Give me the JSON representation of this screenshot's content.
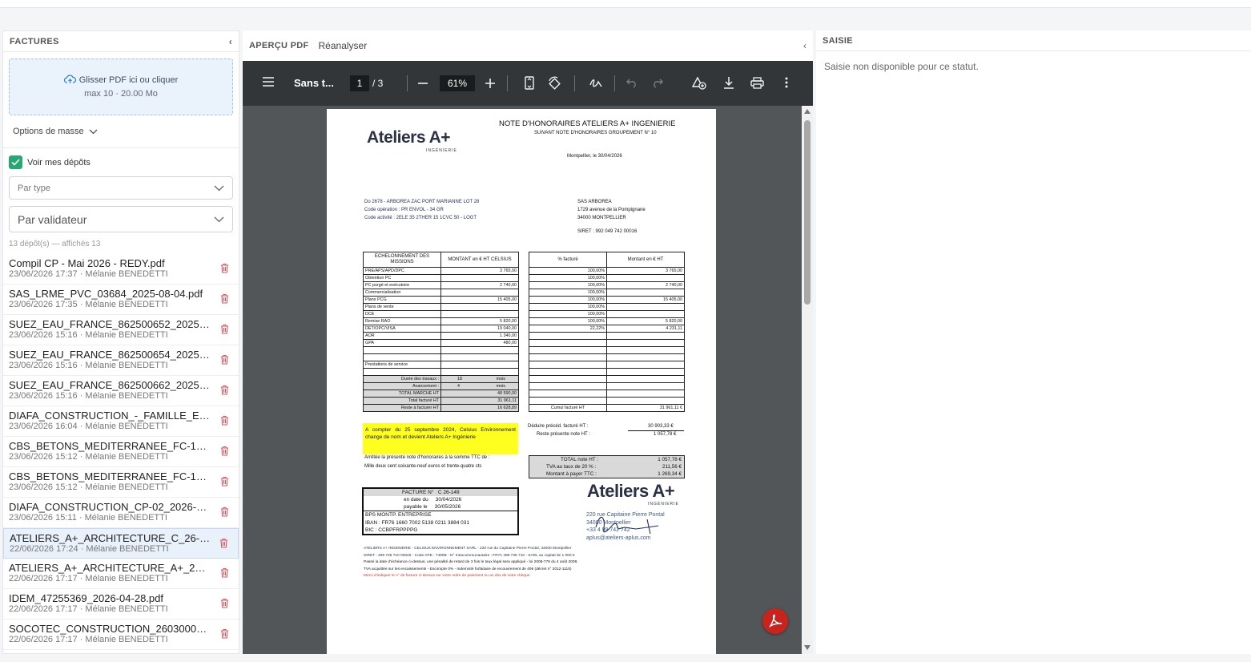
{
  "factures": {
    "title": "FACTURES",
    "collapse_icon": "‹",
    "dropzone_title": "Glisser PDF ici ou cliquer",
    "dropzone_limit": "max 10 · 20.00 Mo",
    "mass_options": "Options de masse",
    "show_mine_label": "Voir mes dépôts",
    "show_mine_checked": true,
    "filter_type": "Par type",
    "filter_validator": "Par validateur",
    "count_text": "13 dépôt(s) — affichés 13",
    "items": [
      {
        "name": "Compil CP - Mai 2026 - REDY.pdf",
        "meta": "23/06/2026 17:37 · Mélanie BENEDETTI"
      },
      {
        "name": "SAS_LRME_PVC_03684_2025-08-04.pdf",
        "meta": "23/06/2026 17:35 · Mélanie BENEDETTI"
      },
      {
        "name": "SUEZ_EAU_FRANCE_862500652_2025-...",
        "meta": "23/06/2026 15:16 · Mélanie BENEDETTI"
      },
      {
        "name": "SUEZ_EAU_FRANCE_862500654_2025-...",
        "meta": "23/06/2026 15:16 · Mélanie BENEDETTI"
      },
      {
        "name": "SUEZ_EAU_FRANCE_862500662_2025-...",
        "meta": "23/06/2026 15:16 · Mélanie BENEDETTI"
      },
      {
        "name": "DIAFA_CONSTRUCTION_-_FAMILLE_EA_...",
        "meta": "23/06/2026 16:04 · Mélanie BENEDETTI"
      },
      {
        "name": "CBS_BETONS_MEDITERRANEE_FC-154...",
        "meta": "23/06/2026 15:12 · Mélanie BENEDETTI"
      },
      {
        "name": "CBS_BETONS_MEDITERRANEE_FC-154...",
        "meta": "23/06/2026 15:12 · Mélanie BENEDETTI"
      },
      {
        "name": "DIAFA_CONSTRUCTION_CP-02_2026-0...",
        "meta": "23/06/2026 15:11 · Mélanie BENEDETTI"
      },
      {
        "name": "ATELIERS_A+_ARCHITECTURE_C_26-14...",
        "meta": "22/06/2026 17:24 · Mélanie BENEDETTI"
      },
      {
        "name": "ATELIERS_A+_ARCHITECTURE_A+_26-2...",
        "meta": "22/06/2026 17:17 · Mélanie BENEDETTI"
      },
      {
        "name": "IDEM_47255369_2026-04-28.pdf",
        "meta": "22/06/2026 17:17 · Mélanie BENEDETTI"
      },
      {
        "name": "SOCOTEC_CONSTRUCTION_26030002...",
        "meta": "22/06/2026 17:17 · Mélanie BENEDETTI"
      }
    ],
    "selected_index": 9
  },
  "preview": {
    "title": "APERÇU PDF",
    "reanalyse": "Réanalyser",
    "collapse_icon": "‹",
    "doc_title": "Sans t...",
    "page_current": "1",
    "page_total": "/ 3",
    "zoom": "61%"
  },
  "pdf": {
    "logo": "Ateliers A+",
    "logo_sub": "INGÉNIERIE",
    "heading": "NOTE D'HONORAIRES ATELIERS A+ INGENIERIE",
    "subheading": "SUIVANT NOTE D'HONORAIRES GROUPEMENT N° 10",
    "place_date": "Montpellier, le    30/04/2026",
    "project_lines": [
      "Do 2678 - ARBOREA ZAC PORT MARIANNE LOT 28",
      "Code opération : PR ENVOL - 34 GR",
      "Code activité : 2ELE 35 2THER 15 1CVC 50 - LOGT"
    ],
    "client_lines": [
      "SAS ARBOREA",
      "1729 avenue de la Pompignane",
      "34000 MONTPELLIER"
    ],
    "siret": "SIRET : 992 049 742 00016",
    "table1_head": [
      "ECHELONNEMENT DES MISSIONS",
      "MONTANT en € HT CELSIUS"
    ],
    "table1_rows": [
      [
        "PRE/APS/APD/DPC",
        "3 765,00"
      ],
      [
        "Obtention PC",
        ""
      ],
      [
        "PC purgé et exécutoire",
        "2 740,00"
      ],
      [
        "Commercialisation",
        ""
      ],
      [
        "Plans PCG",
        "15 405,00"
      ],
      [
        "Plans de vente",
        ""
      ],
      [
        "DCE",
        ""
      ],
      [
        "Remise RAO",
        "5 820,00"
      ],
      [
        "DET/OPC/VISA",
        "19 040,00"
      ],
      [
        "AOR",
        "1 340,00"
      ],
      [
        "GPA",
        "480,00"
      ],
      [
        "",
        ""
      ],
      [
        "",
        ""
      ],
      [
        "Prestations de service",
        ""
      ],
      [
        "",
        ""
      ]
    ],
    "table1_summary": [
      [
        "Durée des travaux :",
        "18",
        "mois"
      ],
      [
        "Avancement :",
        "4",
        "mois"
      ],
      [
        "TOTAL MARCHE HT",
        "48 590,00",
        ""
      ],
      [
        "Total facturé HT",
        "31 961,11",
        ""
      ],
      [
        "Reste à facturer HT",
        "16 628,89",
        ""
      ]
    ],
    "table2_head": [
      "% facturé",
      "Montant en € HT"
    ],
    "table2_rows": [
      [
        "100,00%",
        "3 765,00"
      ],
      [
        "100,00%",
        ""
      ],
      [
        "100,00%",
        "2 740,00"
      ],
      [
        "100,00%",
        ""
      ],
      [
        "100,00%",
        "15 405,00"
      ],
      [
        "100,00%",
        ""
      ],
      [
        "100,00%",
        ""
      ],
      [
        "100,00%",
        "5 820,00"
      ],
      [
        "22,22%",
        "4 231,11"
      ],
      [
        "",
        ""
      ],
      [
        "",
        ""
      ],
      [
        "",
        ""
      ],
      [
        "",
        ""
      ],
      [
        "",
        ""
      ],
      [
        "",
        ""
      ],
      [
        "",
        ""
      ],
      [
        "",
        ""
      ],
      [
        "",
        ""
      ],
      [
        "",
        ""
      ],
      [
        "Cumul facturé HT",
        "31 961,11 €"
      ]
    ],
    "yellow_note": "A compter du 25 septembre 2024, Celsius Environnement change de nom et devient Ateliers A+ Ingénierie",
    "deduct_label": "Déduire précéd. facturé HT :",
    "deduct_value": "30 903,33 €",
    "remaining_label": "Reste présente note HT :",
    "remaining_value": "1 057,78 €",
    "arrete_line1": "Arrêtée la présente note d'honoraires à la somme TTC de :",
    "arrete_line2": "Mille deux cent soixante-neuf euros et trente-quatre cts",
    "totals": [
      [
        "TOTAL note HT :",
        "1 057,78 €"
      ],
      [
        "TVA au taux de 20 % :",
        "211,56 €"
      ],
      [
        "Montant à payer TTC :",
        "1 269,34 €"
      ]
    ],
    "facture_no_label": "FACTURE N°",
    "facture_no": "C 26-149",
    "date_label": "en date du",
    "date_value": "30/04/2026",
    "payable_label": "payable le",
    "payable_value": "30/05/2026",
    "bank_lines": [
      "BPS MONTP. ENTREPRISE",
      "IBAN : FR76 1660 7002 5138 0211 3884 031",
      "BIC : CCBPFRPPPPG"
    ],
    "address_lines": [
      "220 rue Capitaine Pierre Pontal",
      "34000 Montpellier",
      "+33 4 99 742 742",
      "aplus@ateliers-aplus.com"
    ],
    "footer_lines": [
      "ATELIERS A+ INGENIERIE - CELSIUS ENVIRONNEMENT SARL - 220 rue du Capitaine Pierre Pontal, 34000 Montpellier",
      "SIRET : 499 735 710 00026 - Code APE : 7490B - N° Intracommunautaire : FR71 499 735 710 - SARL au capital de 1 000 €",
      "Passé la date d'échéance ci-dessus, une pénalité de retard de 3 fois le taux légal sera appliqué - loi 2008-776 du 4 août 2008.",
      "TVA acquittée sur les encaissements - Escompte 0% - Indemnité forfaitaire de recouvrement de 40€ (décret n° 2012-1115)",
      "Merci d'indiquer le n° de facture ci-dessus sur votre ordre de paiement ou au dos de votre chèque"
    ]
  },
  "saisie": {
    "title": "SAISIE",
    "message": "Saisie non disponible pour ce statut."
  },
  "colors": {
    "accent_green": "#27a872",
    "danger_red": "#e0555d",
    "toolbar_bg": "#323639",
    "viewer_bg": "#525659",
    "highlight_yellow": "#ffff1f"
  }
}
